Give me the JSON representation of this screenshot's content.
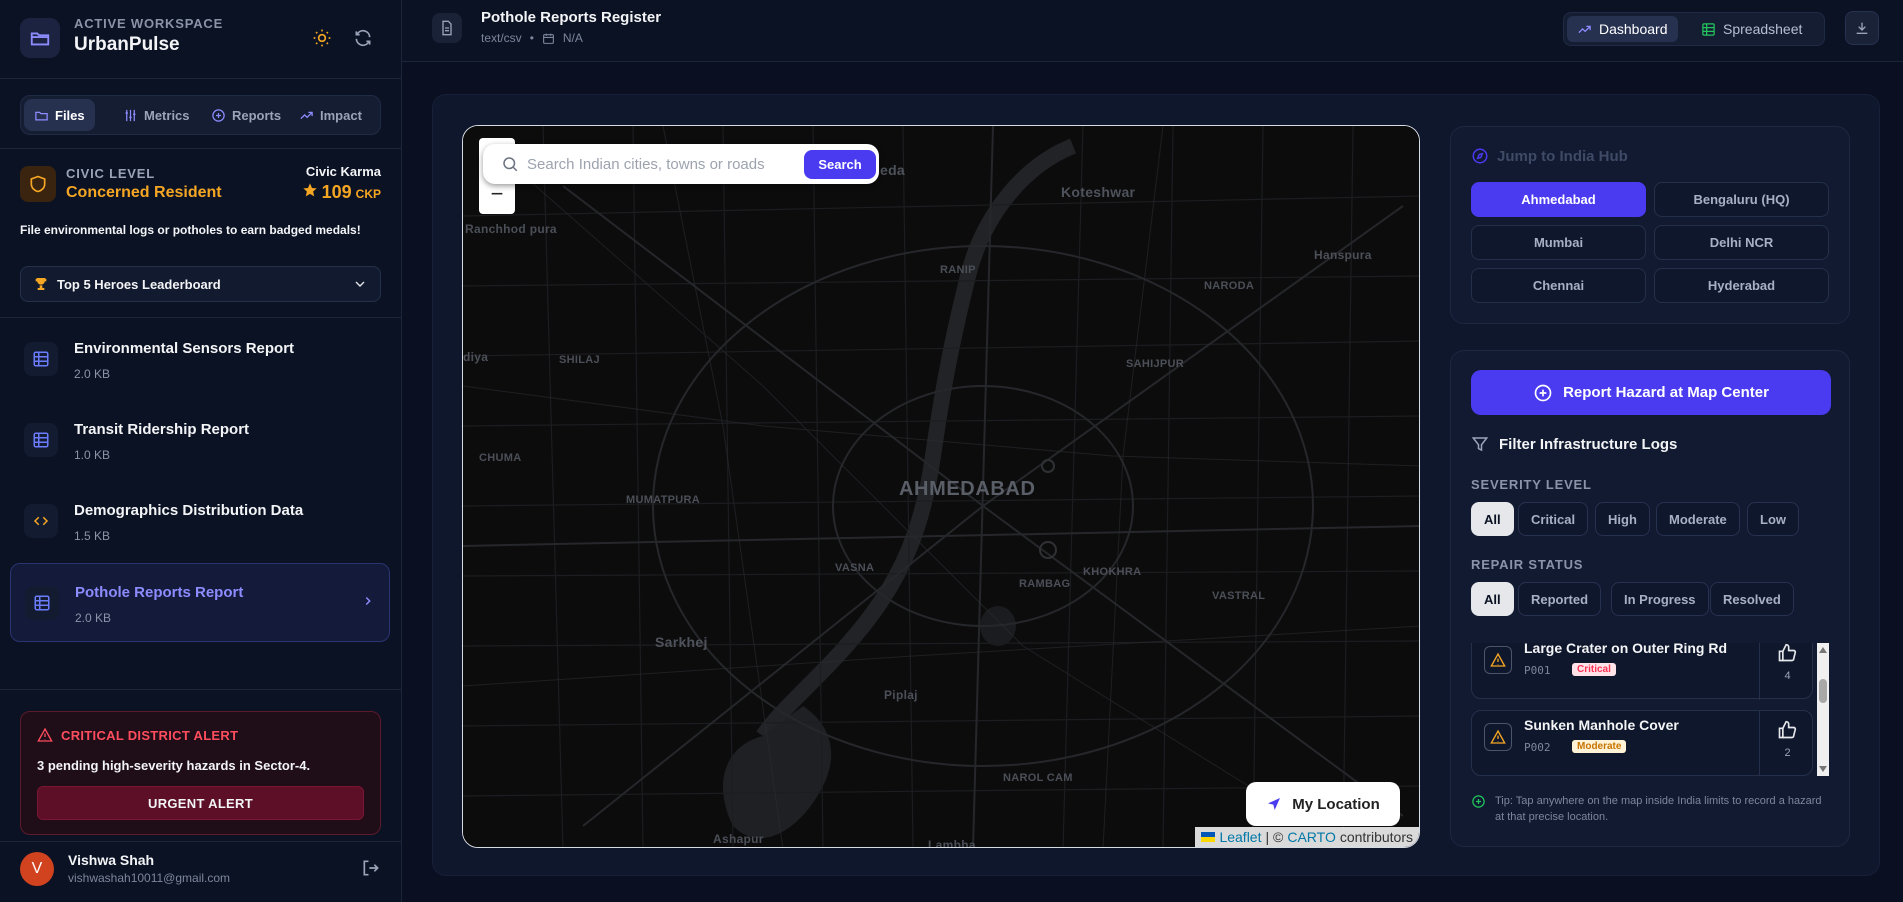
{
  "workspace": {
    "subtitle": "ACTIVE WORKSPACE",
    "name": "UrbanPulse"
  },
  "tabs": [
    {
      "label": "Files",
      "icon": "folder-icon",
      "active": true
    },
    {
      "label": "Metrics",
      "icon": "sliders-icon"
    },
    {
      "label": "Reports",
      "icon": "plus-circle-icon"
    },
    {
      "label": "Impact",
      "icon": "trending-up-icon"
    }
  ],
  "civic": {
    "level_label": "CIVIC LEVEL",
    "level_value": "Concerned Resident",
    "karma_label": "Civic Karma",
    "karma_value": "109",
    "karma_unit": "CKP",
    "message": "File environmental logs or potholes to earn badged medals!"
  },
  "leaderboard": {
    "label": "Top 5 Heroes Leaderboard"
  },
  "files": [
    {
      "name": "Environmental Sensors Report",
      "size": "2.0 KB",
      "icon": "table-icon"
    },
    {
      "name": "Transit Ridership Report",
      "size": "1.0 KB",
      "icon": "table-icon"
    },
    {
      "name": "Demographics Distribution Data",
      "size": "1.5 KB",
      "icon": "code-icon"
    },
    {
      "name": "Pothole Reports Report",
      "size": "2.0 KB",
      "icon": "table-icon",
      "active": true
    }
  ],
  "alert": {
    "title": "CRITICAL DISTRICT ALERT",
    "message": "3 pending high-severity hazards in Sector-4.",
    "button": "URGENT ALERT"
  },
  "user": {
    "initial": "V",
    "name": "Vishwa Shah",
    "email": "vishwashah10011@gmail.com"
  },
  "header": {
    "title": "Pothole Reports Register",
    "mime": "text/csv",
    "separator": "•",
    "date": "N/A",
    "views": [
      {
        "label": "Dashboard",
        "active": true
      },
      {
        "label": "Spreadsheet"
      }
    ]
  },
  "map": {
    "search_placeholder": "Search Indian cities, towns or roads",
    "search_button": "Search",
    "zoom_out": "−",
    "my_location": "My Location",
    "attribution": {
      "leaflet": "Leaflet",
      "sep": "| ©",
      "carto": "CARTO",
      "tail": "contributors"
    },
    "labels": {
      "city": "AHMEDABAD",
      "chandkheda": "Chandkheda",
      "koteshwar": "Koteshwar",
      "ranchhod": "Ranchhod pura",
      "ranip": "RANIP",
      "naroda": "NARODA",
      "hanspura": "Hanspura",
      "diya": "diya",
      "shilaj": "SHILAJ",
      "sahijpur": "SAHIJPUR",
      "chuma": "CHUMA",
      "mumatpura": "MUMATPURA",
      "vasna": "VASNA",
      "rambag": "RAMBAG",
      "khokhra": "KHOKHRA",
      "vastral": "VASTRAL",
      "sarkhej": "Sarkhej",
      "piplaj": "Piplaj",
      "narol": "NAROL CAM",
      "ashapur": "Ashapur",
      "lambha": "Lambha"
    }
  },
  "hub": {
    "title": "Jump to India Hub",
    "cities": [
      "Ahmedabad",
      "Bengaluru (HQ)",
      "Mumbai",
      "Delhi NCR",
      "Chennai",
      "Hyderabad"
    ],
    "active": "Ahmedabad"
  },
  "logs": {
    "report_button": "Report Hazard at Map Center",
    "filter_title": "Filter Infrastructure Logs",
    "severity_label": "SEVERITY LEVEL",
    "severity": [
      "All",
      "Critical",
      "High",
      "Moderate",
      "Low"
    ],
    "status_label": "REPAIR STATUS",
    "status": [
      "All",
      "Reported",
      "In Progress",
      "Resolved"
    ],
    "items": [
      {
        "title": "Large Crater on Outer Ring Rd",
        "id": "P001",
        "severity": "Critical",
        "votes": "4"
      },
      {
        "title": "Sunken Manhole Cover",
        "id": "P002",
        "severity": "Moderate",
        "votes": "2"
      }
    ],
    "tip": "Tip: Tap anywhere on the map inside India limits to record a hazard at that precise location."
  },
  "colors": {
    "accent": "#4a3bf0",
    "warning": "#f5a623",
    "danger": "#ff4d5e",
    "critical_badge": "#e0163b",
    "moderate_badge": "#d98a00"
  }
}
